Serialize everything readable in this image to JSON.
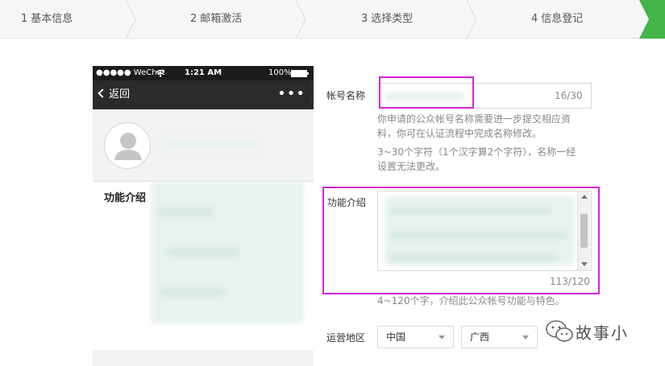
{
  "steps": [
    {
      "num": "1",
      "label": "基本信息"
    },
    {
      "num": "2",
      "label": "邮箱激活"
    },
    {
      "num": "3",
      "label": "选择类型"
    },
    {
      "num": "4",
      "label": "信息登记"
    }
  ],
  "phone": {
    "status": {
      "carrier": "●●●●● WeChat",
      "time": "1:21 AM",
      "battery": "100%"
    },
    "nav": {
      "back_label": "返回",
      "more_label": "•••"
    },
    "intro_label": "功能介绍"
  },
  "form": {
    "account_name": {
      "label": "帐号名称",
      "count": "16/30",
      "hint1": "你申请的公众帐号名称需要进一步提交相应资",
      "hint2": "料，你可在认证流程中完成名称修改。",
      "hint3": "3~30个字符（1个汉字算2个字符），名称一经",
      "hint4": "设置无法更改。"
    },
    "intro": {
      "label": "功能介绍",
      "count": "113/120",
      "hint": "4~120个字，介绍此公众帐号功能与特色。"
    },
    "region": {
      "label": "运营地区",
      "country": "中国",
      "province": "广西"
    }
  },
  "watermark": {
    "text": "故事小"
  },
  "colors": {
    "step_active": "#44b549",
    "highlight": "#d626d6",
    "nav_bg": "#2b2b2b"
  }
}
